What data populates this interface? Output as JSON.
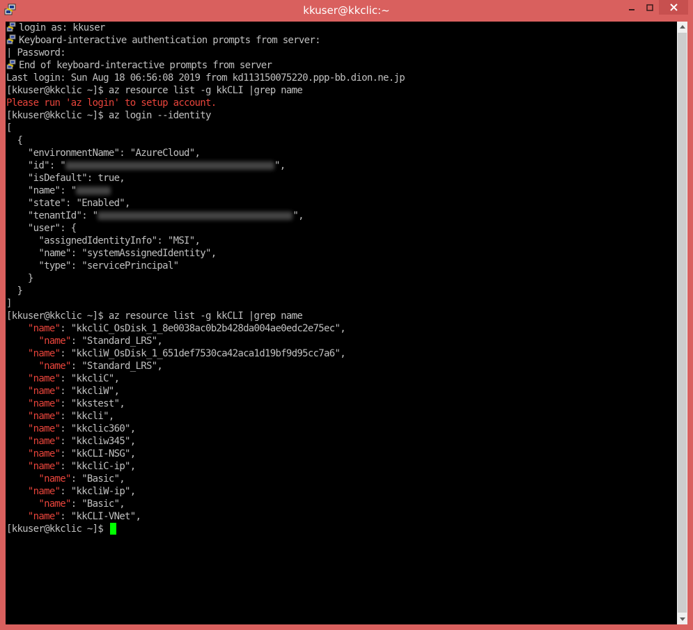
{
  "window": {
    "title": "kkuser@kkclic:~"
  },
  "terminal": {
    "lines": [
      {
        "icon": true,
        "text": "login as: kkuser"
      },
      {
        "icon": true,
        "text": "Keyboard-interactive authentication prompts from server:"
      },
      {
        "text": "| Password:"
      },
      {
        "icon": true,
        "text": "End of keyboard-interactive prompts from server"
      },
      {
        "text": "Last login: Sun Aug 18 06:56:08 2019 from kd113150075220.ppp-bb.dion.ne.jp"
      },
      {
        "text": "[kkuser@kkclic ~]$ az resource list -g kkCLI |grep name"
      },
      {
        "text": "Please run 'az login' to setup account.",
        "color": "red"
      },
      {
        "text": "[kkuser@kkclic ~]$ az login --identity"
      },
      {
        "text": "["
      },
      {
        "text": "  {"
      },
      {
        "text": "    \"environmentName\": \"AzureCloud\","
      },
      {
        "text": "    \"id\": \"",
        "blur": 300,
        "after": "\","
      },
      {
        "text": "    \"isDefault\": true,"
      },
      {
        "text": "    \"name\": \"",
        "blur": 50,
        "after": ""
      },
      {
        "text": "    \"state\": \"Enabled\","
      },
      {
        "text": "    \"tenantId\": \"",
        "blur": 280,
        "after": "\","
      },
      {
        "text": "    \"user\": {"
      },
      {
        "text": "      \"assignedIdentityInfo\": \"MSI\","
      },
      {
        "text": "      \"name\": \"systemAssignedIdentity\","
      },
      {
        "text": "      \"type\": \"servicePrincipal\""
      },
      {
        "text": "    }"
      },
      {
        "text": "  }"
      },
      {
        "text": "]"
      },
      {
        "text": "[kkuser@kkclic ~]$ az resource list -g kkCLI |grep name"
      },
      {
        "indent": "    ",
        "key": "\"name\"",
        "rest": ": \"kkcliC_OsDisk_1_8e0038ac0b2b428da004ae0edc2e75ec\","
      },
      {
        "indent": "      ",
        "key": "\"name\"",
        "rest": ": \"Standard_LRS\","
      },
      {
        "indent": "    ",
        "key": "\"name\"",
        "rest": ": \"kkcliW_OsDisk_1_651def7530ca42aca1d19bf9d95cc7a6\","
      },
      {
        "indent": "      ",
        "key": "\"name\"",
        "rest": ": \"Standard_LRS\","
      },
      {
        "indent": "    ",
        "key": "\"name\"",
        "rest": ": \"kkcliC\","
      },
      {
        "indent": "    ",
        "key": "\"name\"",
        "rest": ": \"kkcliW\","
      },
      {
        "indent": "    ",
        "key": "\"name\"",
        "rest": ": \"kkstest\","
      },
      {
        "indent": "    ",
        "key": "\"name\"",
        "rest": ": \"kkcli\","
      },
      {
        "indent": "    ",
        "key": "\"name\"",
        "rest": ": \"kkclic360\","
      },
      {
        "indent": "    ",
        "key": "\"name\"",
        "rest": ": \"kkcliw345\","
      },
      {
        "indent": "    ",
        "key": "\"name\"",
        "rest": ": \"kkCLI-NSG\","
      },
      {
        "indent": "    ",
        "key": "\"name\"",
        "rest": ": \"kkcliC-ip\","
      },
      {
        "indent": "      ",
        "key": "\"name\"",
        "rest": ": \"Basic\","
      },
      {
        "indent": "    ",
        "key": "\"name\"",
        "rest": ": \"kkcliW-ip\","
      },
      {
        "indent": "      ",
        "key": "\"name\"",
        "rest": ": \"Basic\","
      },
      {
        "indent": "    ",
        "key": "\"name\"",
        "rest": ": \"kkCLI-VNet\","
      },
      {
        "text": "[kkuser@kkclic ~]$ ",
        "cursor": true
      }
    ]
  },
  "colors": {
    "titlebar": "#d9605e",
    "terminal_bg": "#000000",
    "text": "#c0c0c0",
    "error": "#e8443b",
    "cursor": "#00ff00"
  }
}
